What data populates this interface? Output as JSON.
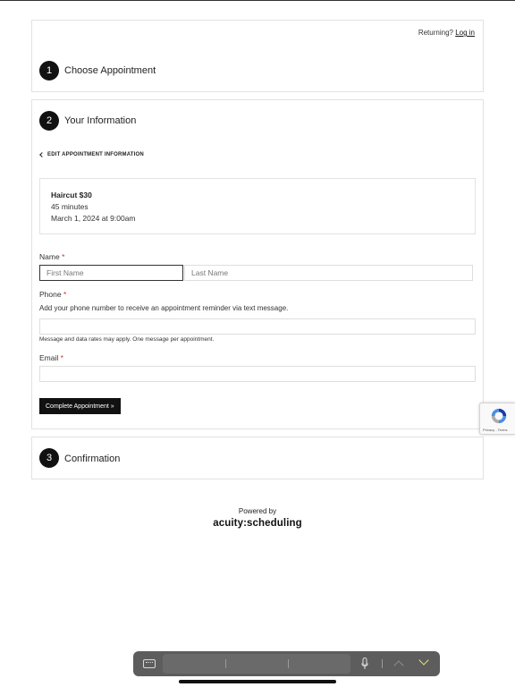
{
  "returning": {
    "text": "Returning?",
    "login_label": "Log in"
  },
  "steps": {
    "one": {
      "number": "1",
      "title": "Choose Appointment"
    },
    "two": {
      "number": "2",
      "title": "Your Information"
    },
    "three": {
      "number": "3",
      "title": "Confirmation"
    }
  },
  "edit_link": {
    "label": "EDIT APPOINTMENT INFORMATION"
  },
  "appointment": {
    "service": "Haircut $30",
    "duration": "45 minutes",
    "datetime": "March 1, 2024 at 9:00am"
  },
  "form": {
    "name_label": "Name",
    "required_mark": "*",
    "first_name_placeholder": "First Name",
    "last_name_placeholder": "Last Name",
    "first_name_value": "",
    "last_name_value": "",
    "phone_label": "Phone",
    "phone_help": "Add your phone number to receive an appointment reminder via text message.",
    "phone_value": "",
    "phone_note": "Message and data rates may apply. One message per appointment.",
    "email_label": "Email",
    "email_value": "",
    "submit_label": "Complete Appointment »"
  },
  "recaptcha": {
    "terms": "Privacy - Terms"
  },
  "footer": {
    "powered_by": "Powered by",
    "brand": "acuity:scheduling"
  },
  "colors": {
    "accent": "#111111",
    "required": "#c0392b",
    "border": "#e2e2e2",
    "keyboard_done": "#e6e86a"
  },
  "icons": {
    "back": "chevron-left-icon",
    "keyboard": "keyboard-icon",
    "mic": "microphone-icon",
    "prev": "chevron-up-icon",
    "next": "chevron-down-icon",
    "recaptcha": "recaptcha-icon"
  }
}
